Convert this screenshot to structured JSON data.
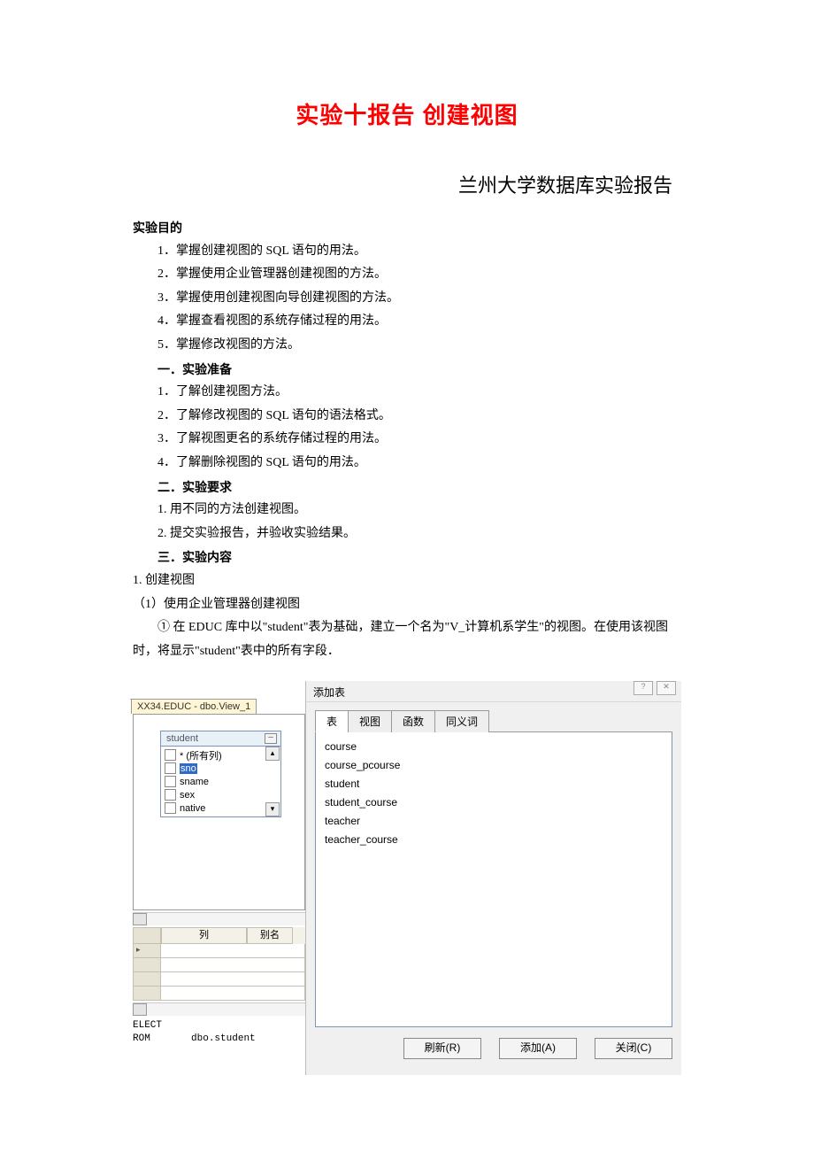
{
  "title": "实验十报告 创建视图",
  "subtitle": "兰州大学数据库实验报告",
  "h_purpose": "实验目的",
  "purpose": [
    "1．掌握创建视图的 SQL 语句的用法。",
    "2．掌握使用企业管理器创建视图的方法。",
    "3．掌握使用创建视图向导创建视图的方法。",
    "4．掌握查看视图的系统存储过程的用法。",
    "5．掌握修改视图的方法。"
  ],
  "h_prep": "一．实验准备",
  "prep": [
    "1．了解创建视图方法。",
    "2．了解修改视图的 SQL 语句的语法格式。",
    "3．了解视图更名的系统存储过程的用法。",
    "4．了解删除视图的 SQL 语句的用法。"
  ],
  "h_req": "二．实验要求",
  "req": [
    "1. 用不同的方法创建视图。",
    "2. 提交实验报告，并验收实验结果。"
  ],
  "h_content": "三．实验内容",
  "content_1": "1. 创建视图",
  "content_1_1": "（1）使用企业管理器创建视图",
  "content_para": "①  在 EDUC 库中以\"student\"表为基础，建立一个名为\"V_计算机系学生\"的视图。在使用该视图时，将显示\"student\"表中的所有字段．",
  "screenshot": {
    "left": {
      "tab": "XX34.EDUC - dbo.View_1",
      "table_box": {
        "name": "student",
        "cols": [
          "* (所有列)",
          "sno",
          "sname",
          "sex",
          "native"
        ],
        "selected": "sno"
      },
      "grid_headers": {
        "col": "列",
        "alias": "别名"
      },
      "sql": {
        "l1": "ELECT",
        "l2_left": "ROM",
        "l2_right": "dbo.student"
      }
    },
    "dialog": {
      "title": "添加表",
      "tabs": [
        "表",
        "视图",
        "函数",
        "同义词"
      ],
      "items": [
        "course",
        "course_pcourse",
        "student",
        "student_course",
        "teacher",
        "teacher_course"
      ],
      "buttons": {
        "refresh": "刷新(R)",
        "add": "添加(A)",
        "close": "关闭(C)"
      }
    }
  }
}
